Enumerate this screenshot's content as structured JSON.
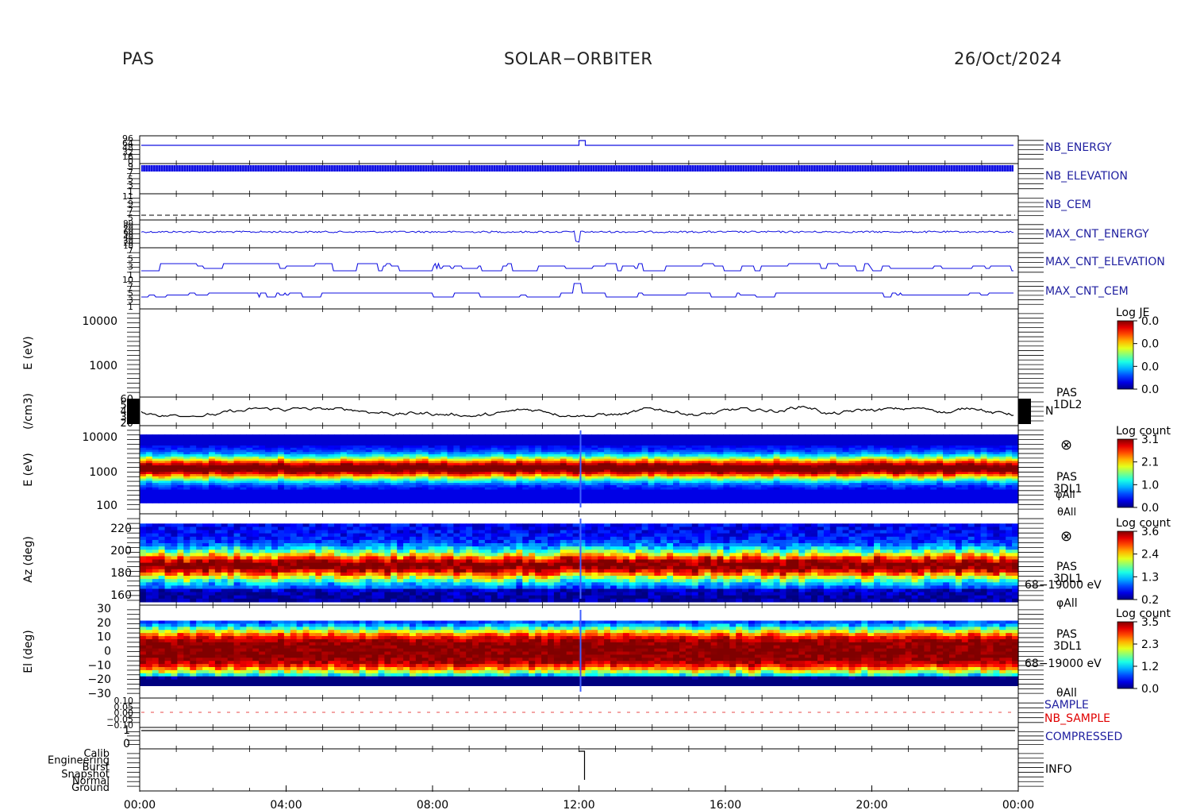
{
  "header": {
    "instrument": "PAS",
    "mission": "SOLAR−ORBITER",
    "date": "26/Oct/2024"
  },
  "colors": {
    "panel_trace": "#1010e0",
    "label_blue": "#2020a0",
    "label_red": "#e00000",
    "axis": "#000000"
  },
  "chart_data": [
    {
      "type": "line",
      "label": "NB_ENERGY",
      "ticks": [
        "96",
        "64",
        "48",
        "32",
        "16",
        "0"
      ],
      "series": [
        {
          "step_at": "12:00",
          "before": 64,
          "after": 96
        }
      ]
    },
    {
      "type": "line",
      "label": "NB_ELEVATION",
      "ticks": [
        "9",
        "7",
        "5",
        "3",
        "1"
      ],
      "series": [
        {
          "pattern": "rapid oscillation",
          "range": [
            7,
            8
          ]
        }
      ]
    },
    {
      "type": "line",
      "label": "NB_CEM",
      "ticks": [
        "11",
        "9",
        "7",
        "5"
      ],
      "series": [
        {
          "value": 3,
          "style": "dashed"
        }
      ]
    },
    {
      "type": "line",
      "label": "MAX_CNT_ENERGY",
      "ticks": [
        "90",
        "80",
        "70",
        "60",
        "50",
        "40",
        "30",
        "20",
        "10"
      ],
      "series": [
        {
          "mean": 60
        }
      ]
    },
    {
      "type": "line",
      "label": "MAX_CNT_ELEVATION",
      "ticks": [
        "7",
        "5",
        "3",
        "1"
      ],
      "series": [
        {
          "range": [
            1,
            4
          ]
        }
      ]
    },
    {
      "type": "line",
      "label": "MAX_CNT_CEM",
      "ticks": [
        "10",
        "7",
        "5",
        "3",
        "1"
      ],
      "series": [
        {
          "range": [
            1,
            3
          ]
        }
      ]
    },
    {
      "type": "heatmap",
      "ylabel": "E (eV)",
      "yticks": [
        "10000",
        "1000"
      ],
      "colorbar": {
        "title": "Log JE",
        "ticks": [
          "0.0",
          "0.0",
          "0.0",
          "0.0"
        ]
      }
    },
    {
      "type": "line",
      "ylabel": "(/cm3)",
      "yticks": [
        "60",
        "50",
        "40",
        "30",
        "20"
      ],
      "side_label": [
        "PAS",
        "1DL2"
      ],
      "side_sub": "N",
      "series": [
        {
          "mean": 32,
          "range": [
            20,
            48
          ]
        }
      ]
    },
    {
      "type": "heatmap",
      "ylabel": "E (eV)",
      "yticks": [
        "10000",
        "1000",
        "100"
      ],
      "side_label": [
        "PAS",
        "3DL1"
      ],
      "side_sub": [
        "φAll",
        "θAll"
      ],
      "colorbar": {
        "title": "Log count",
        "ticks": [
          "3.1",
          "2.1",
          "1.0",
          "0.0"
        ]
      },
      "peak_energy_eV": 700
    },
    {
      "type": "heatmap",
      "ylabel": "Az (deg)",
      "yticks": [
        "220",
        "200",
        "180",
        "160"
      ],
      "side_label": [
        "PAS",
        "3DL1"
      ],
      "side_sub": [
        "68−19000 eV",
        "φAll"
      ],
      "colorbar": {
        "title": "Log count",
        "ticks": [
          "3.6",
          "2.4",
          "1.3",
          "0.2"
        ]
      },
      "peak_deg": 182
    },
    {
      "type": "heatmap",
      "ylabel": "El (deg)",
      "yticks": [
        "30",
        "20",
        "10",
        "0",
        "−10",
        "−20",
        "−30"
      ],
      "side_label": [
        "PAS",
        "3DL1"
      ],
      "side_sub": [
        "68−19000 eV",
        "θAll"
      ],
      "colorbar": {
        "title": "Log count",
        "ticks": [
          "3.5",
          "2.3",
          "1.2",
          "0.0"
        ]
      },
      "peak_deg": -2
    },
    {
      "type": "line",
      "label": [
        "SAMPLE",
        "NB_SAMPLE"
      ],
      "ticks": [
        "0.10",
        "0.05",
        "0.00",
        "−0.05",
        "−0.10"
      ],
      "series": [
        {
          "name": "NB_SAMPLE",
          "value": 0.0,
          "style": "dashed"
        }
      ]
    },
    {
      "type": "line",
      "label": "COMPRESSED",
      "ticks": [
        "1",
        "0"
      ],
      "series": [
        {
          "value": 1
        }
      ]
    },
    {
      "type": "line",
      "label": "INFO",
      "ticks": [
        "Calib",
        "Engineering",
        "Burst",
        "Snapshot",
        "Normal",
        "Ground"
      ],
      "series": [
        {
          "step_at": "12:00",
          "from": "Calib",
          "to": "Ground"
        }
      ]
    }
  ],
  "x_axis": {
    "ticks": [
      "00:00",
      "04:00",
      "08:00",
      "12:00",
      "16:00",
      "20:00",
      "00:00"
    ]
  }
}
